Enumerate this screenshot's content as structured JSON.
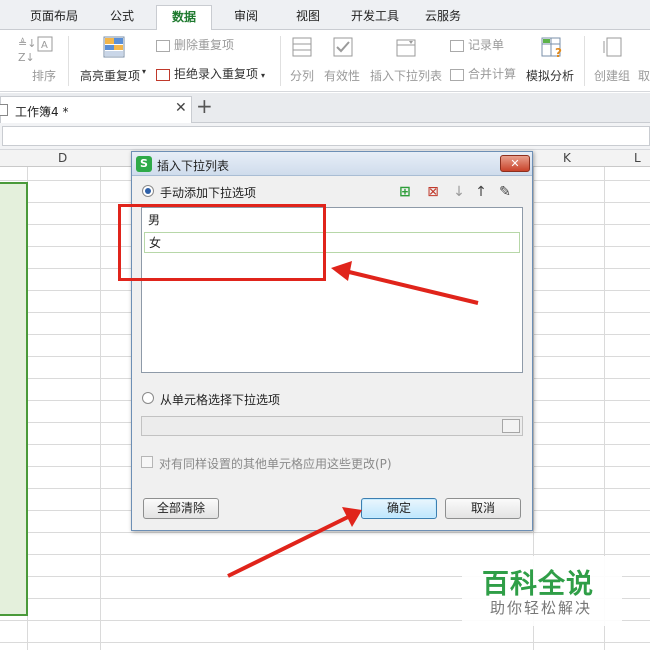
{
  "ribbon_tabs": [
    "页面布局",
    "公式",
    "数据",
    "审阅",
    "视图",
    "开发工具",
    "云服务"
  ],
  "active_tab": "数据",
  "ribbon": {
    "sort_label": "排序",
    "highlight_dup_label": "高亮重复项",
    "delete_dup_label": "删除重复项",
    "reject_dup_label": "拒绝录入重复项",
    "split_label": "分列",
    "validity_label": "有效性",
    "insert_dropdown_label": "插入下拉列表",
    "record_label": "记录单",
    "merge_calc_label": "合并计算",
    "simulate_label": "模拟分析",
    "create_group_label": "创建组",
    "cut_label": "取"
  },
  "document_tab": {
    "label": "工作簿4 *"
  },
  "columns": [
    "D",
    "K",
    "L"
  ],
  "dialog": {
    "title": "插入下拉列表",
    "manual_option": "手动添加下拉选项",
    "items": [
      "男",
      "女"
    ],
    "from_cells_option": "从单元格选择下拉选项",
    "apply_all_label": "对有同样设置的其他单元格应用这些更改(P)",
    "clear_all": "全部清除",
    "ok": "确定",
    "cancel": "取消"
  },
  "watermark": {
    "main": "百科全说",
    "sub": "助你轻松解决"
  },
  "colors": {
    "accent_green": "#2f9e47",
    "annotation_red": "#e0241b",
    "selection_green": "#4a9a3a"
  }
}
